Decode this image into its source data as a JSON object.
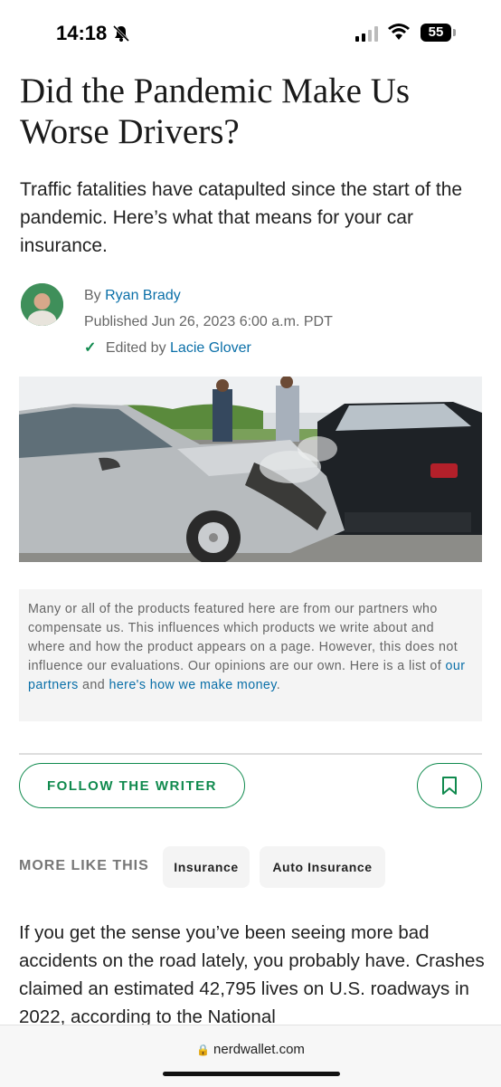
{
  "status_bar": {
    "time": "14:18",
    "battery": "55"
  },
  "article": {
    "headline": "Did the Pandemic Make Us Worse Drivers?",
    "subhead": "Traffic fatalities have catapulted since the start of the pandemic. Here’s what that means for your car insurance.",
    "byline": {
      "by_prefix": "By",
      "author": "Ryan Brady",
      "published": "Published Jun 26, 2023 6:00 a.m. PDT",
      "edited_prefix": "Edited by",
      "editor": "Lacie Glover"
    }
  },
  "disclosure": {
    "text": "Many or all of the products featured here are from our partners who compensate us. This influences which products we write about and where and how the product appears on a page. However, this does not influence our evaluations. Our opinions are our own. Here is a list of",
    "partners_link": "our partners",
    "and": "and",
    "money_link": "here's how we make money",
    "end": "."
  },
  "actions": {
    "follow_label": "FOLLOW THE WRITER"
  },
  "more_like_this": {
    "label": "MORE LIKE THIS",
    "tags": [
      "Insurance",
      "Auto Insurance"
    ]
  },
  "body": {
    "first_paragraph": "If you get the sense you’ve been seeing more bad accidents on the road lately, you probably have. Crashes claimed an estimated 42,795 lives on U.S. roadways in 2022, according to the National"
  },
  "browser": {
    "url": "nerdwallet.com"
  },
  "colors": {
    "accent": "#108a4e",
    "link": "#0a6fa8"
  }
}
